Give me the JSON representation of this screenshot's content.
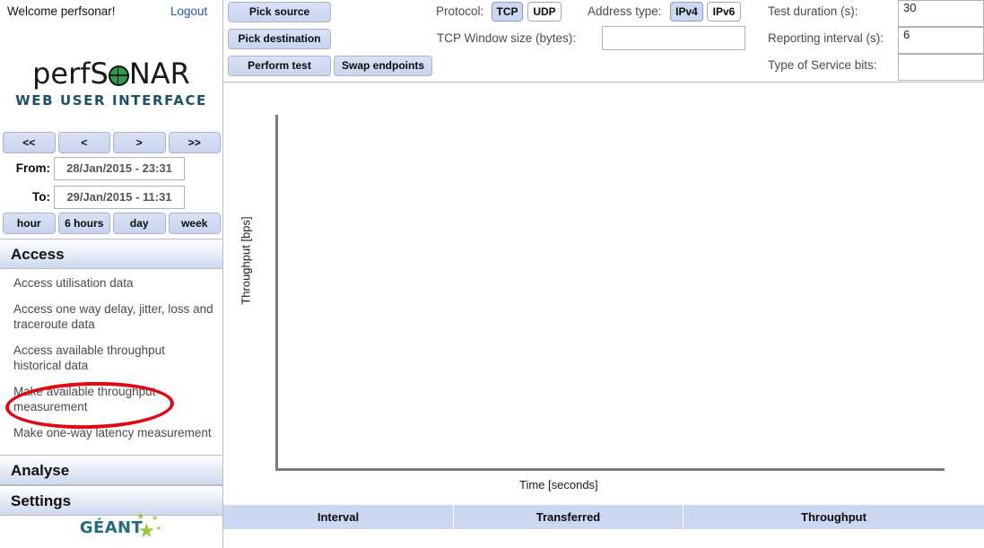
{
  "sidebar": {
    "welcome": "Welcome perfsonar!",
    "logout_label": "Logout",
    "brand": {
      "part1": "perfS",
      "globe": "globe-icon",
      "part2": "NAR",
      "subtitle": "WEB USER INTERFACE"
    },
    "range_nav": {
      "first_label": "<<",
      "prev_label": "<",
      "next_label": ">",
      "last_label": ">>"
    },
    "date_range": {
      "from_label": "From:",
      "from_value": "28/Jan/2015 - 23:31",
      "to_label": "To:",
      "to_value": "29/Jan/2015 - 11:31"
    },
    "presets": {
      "hour_label": "hour",
      "six_hours_label": "6 hours",
      "day_label": "day",
      "week_label": "week"
    },
    "sections": [
      {
        "title": "Access"
      },
      {
        "title": "Analyse"
      },
      {
        "title": "Settings"
      }
    ],
    "access_items": [
      "Access utilisation data",
      "Access one way delay, jitter, loss and traceroute data",
      "Access available throughput historical data",
      "Make available throughput measurement",
      "Make one-way latency measurement"
    ],
    "footer_logo": {
      "text": "GÉANT"
    },
    "annotation": {
      "shape": "ellipse",
      "color": "#e30613",
      "targets": "Make available throughput measurement"
    }
  },
  "toolbar": {
    "pick_source_label": "Pick source",
    "pick_destination_label": "Pick destination",
    "perform_test_label": "Perform test",
    "swap_endpoints_label": "Swap endpoints",
    "protocol_label": "Protocol:",
    "protocol_tcp_label": "TCP",
    "protocol_udp_label": "UDP",
    "protocol_selected": "TCP",
    "tcp_window_label": "TCP Window size (bytes):",
    "tcp_window_value": "",
    "address_type_label": "Address type:",
    "address_ipv4_label": "IPv4",
    "address_ipv6_label": "IPv6",
    "address_selected": "IPv4",
    "test_duration_label": "Test duration (s):",
    "test_duration_value": "30",
    "reporting_interval_label": "Reporting interval (s):",
    "reporting_interval_value": "6",
    "tos_label": "Type of Service bits:",
    "tos_value": ""
  },
  "chart_data": {
    "type": "line",
    "title": "",
    "xlabel": "Time [seconds]",
    "ylabel": "Throughput [bps]",
    "x": [],
    "series": [],
    "grid": false,
    "legend": "none",
    "note": "empty plot - axes drawn, no data plotted"
  },
  "results": {
    "columns": [
      "Interval",
      "Transferred",
      "Throughput"
    ],
    "rows": []
  },
  "colors": {
    "accent_blue": "#ccd8f2",
    "button_blue": "#d9e1f5",
    "annotation_red": "#e30613",
    "brand_teal": "#1f4f63",
    "link_blue": "#2255bb",
    "geant_green": "#9ec93c"
  }
}
